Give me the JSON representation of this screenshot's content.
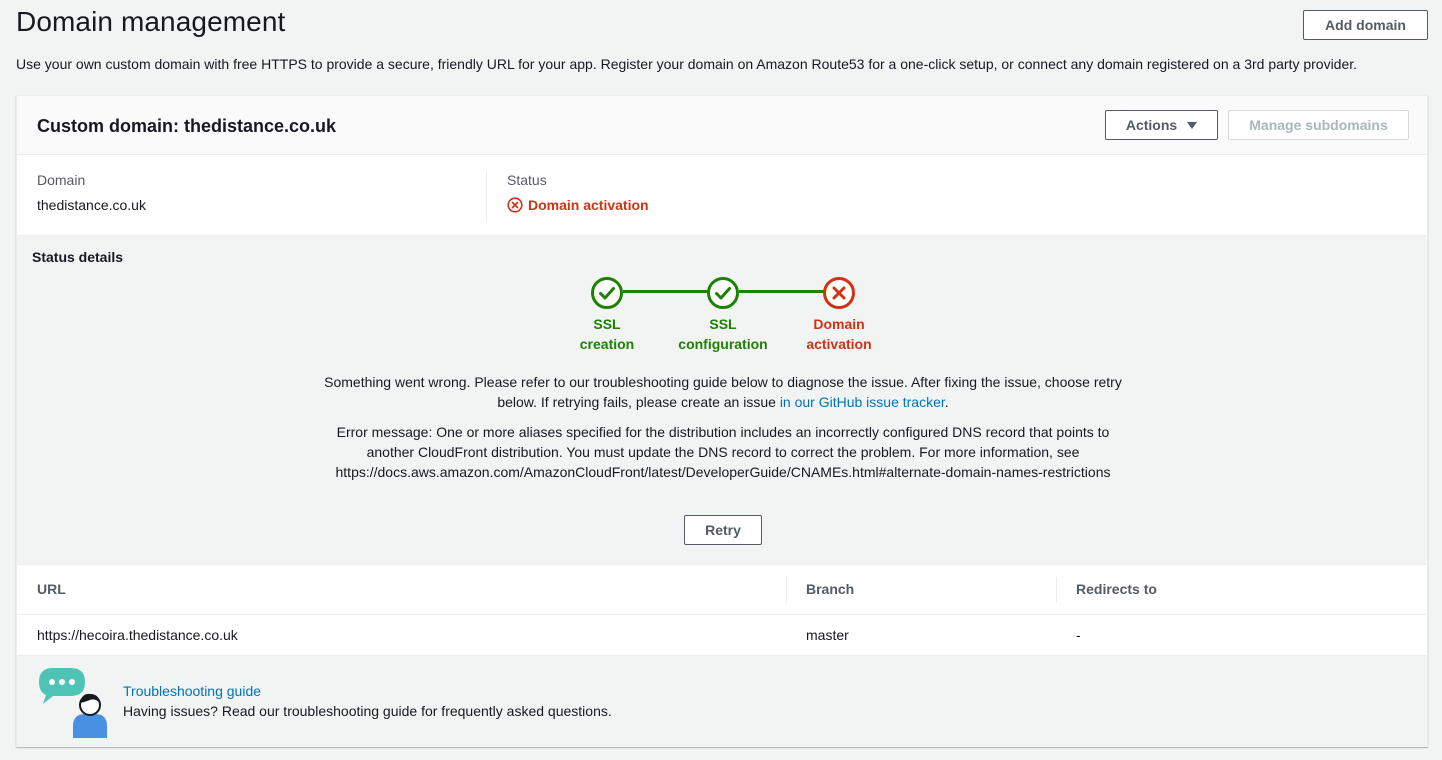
{
  "header": {
    "title": "Domain management",
    "add_domain_label": "Add domain",
    "description": "Use your own custom domain with free HTTPS to provide a secure, friendly URL for your app. Register your domain on Amazon Route53 for a one-click setup, or connect any domain registered on a 3rd party provider."
  },
  "card": {
    "title": "Custom domain: thedistance.co.uk",
    "actions_label": "Actions",
    "manage_subdomains_label": "Manage subdomains",
    "domain_label": "Domain",
    "domain_value": "thedistance.co.uk",
    "status_label": "Status",
    "status_value": "Domain activation"
  },
  "status_details": {
    "title": "Status details",
    "steps": [
      {
        "line1": "SSL",
        "line2": "creation",
        "state": "success"
      },
      {
        "line1": "SSL",
        "line2": "configuration",
        "state": "success"
      },
      {
        "line1": "Domain",
        "line2": "activation",
        "state": "failed"
      }
    ],
    "message_text": "Something went wrong. Please refer to our troubleshooting guide below to diagnose the issue. After fixing the issue, choose retry below. If retrying fails, please create an issue ",
    "message_link": "in our GitHub issue tracker",
    "message_end": ".",
    "error_message": "Error message: One or more aliases specified for the distribution includes an incorrectly configured DNS record that points to another CloudFront distribution. You must update the DNS record to correct the problem. For more information, see https://docs.aws.amazon.com/AmazonCloudFront/latest/DeveloperGuide/CNAMEs.html#alternate-domain-names-restrictions",
    "retry_label": "Retry"
  },
  "table": {
    "columns": [
      "URL",
      "Branch",
      "Redirects to"
    ],
    "rows": [
      {
        "url": "https://hecoira.thedistance.co.uk",
        "branch": "master",
        "redirects": "-"
      }
    ]
  },
  "troubleshooting": {
    "link": "Troubleshooting guide",
    "description": "Having issues? Read our troubleshooting guide for frequently asked questions."
  },
  "colors": {
    "success": "#1d8102",
    "error": "#d13212",
    "link": "#0073bb",
    "chat_bubble": "#4fc3b5",
    "person": "#4a90e2"
  }
}
